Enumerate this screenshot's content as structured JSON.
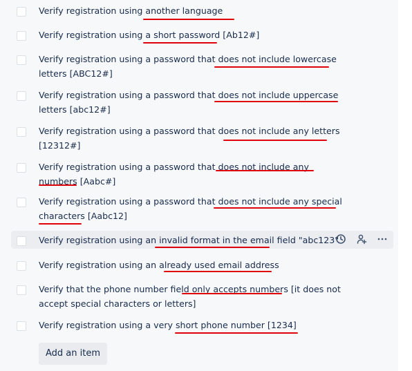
{
  "checklist": {
    "items": [
      {
        "label": "Verify registration using another language"
      },
      {
        "label": "Verify registration using a short password [Ab12#]"
      },
      {
        "label": "Verify registration using a password that does not include lowercase letters [ABC12#]"
      },
      {
        "label": "Verify registration using a password that does not include uppercase letters [abc12#]"
      },
      {
        "label": "Verify registration using a password that does not include any letters [12312#]"
      },
      {
        "label": "Verify registration using a password that does not include any numbers [Aabc#]"
      },
      {
        "label": "Verify registration using a password that does not include any special characters [Aabc12]"
      },
      {
        "label": "Verify registration using an invalid format in the email field \"abc123\""
      },
      {
        "label": "Verify registration using an already used email address"
      },
      {
        "label": "Verify that the phone number field only accepts numbers [it does not accept special characters or letters]"
      },
      {
        "label": "Verify registration using a very short phone number [1234]"
      }
    ],
    "hovered_index": 7,
    "add_item_label": "Add an item",
    "row_actions": {
      "icons": [
        "clock-icon",
        "assign-user-icon",
        "more-icon"
      ]
    }
  },
  "colors": {
    "panel_bg": "#f7f8f9",
    "text": "#172b4d",
    "annotation_red": "#e0000a",
    "checkbox_border": "#dcdfe4"
  }
}
